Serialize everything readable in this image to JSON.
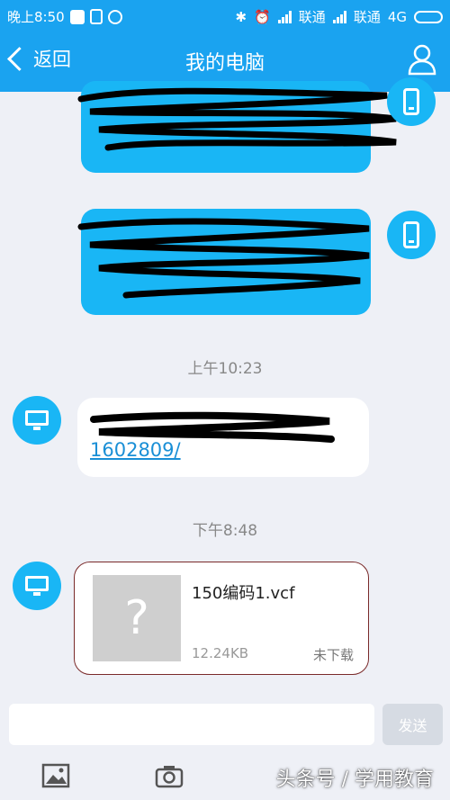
{
  "status_bar": {
    "time": "晚上8:50",
    "carrier1": "联通",
    "carrier2": "联通",
    "network": "4G"
  },
  "header": {
    "back_label": "返回",
    "title": "我的电脑"
  },
  "messages": {
    "time1": "上午10:23",
    "link_line2": "1602809/",
    "time2": "下午8:48",
    "file": {
      "name": "150编码1.vcf",
      "size": "12.24KB",
      "status": "未下载",
      "thumb_glyph": "?"
    }
  },
  "input": {
    "send_label": "发送"
  },
  "watermark": "头条号 / 学用教育",
  "colors": {
    "accent": "#1aa3f0",
    "bubble": "#19b6f5",
    "background": "#eef0f6"
  }
}
